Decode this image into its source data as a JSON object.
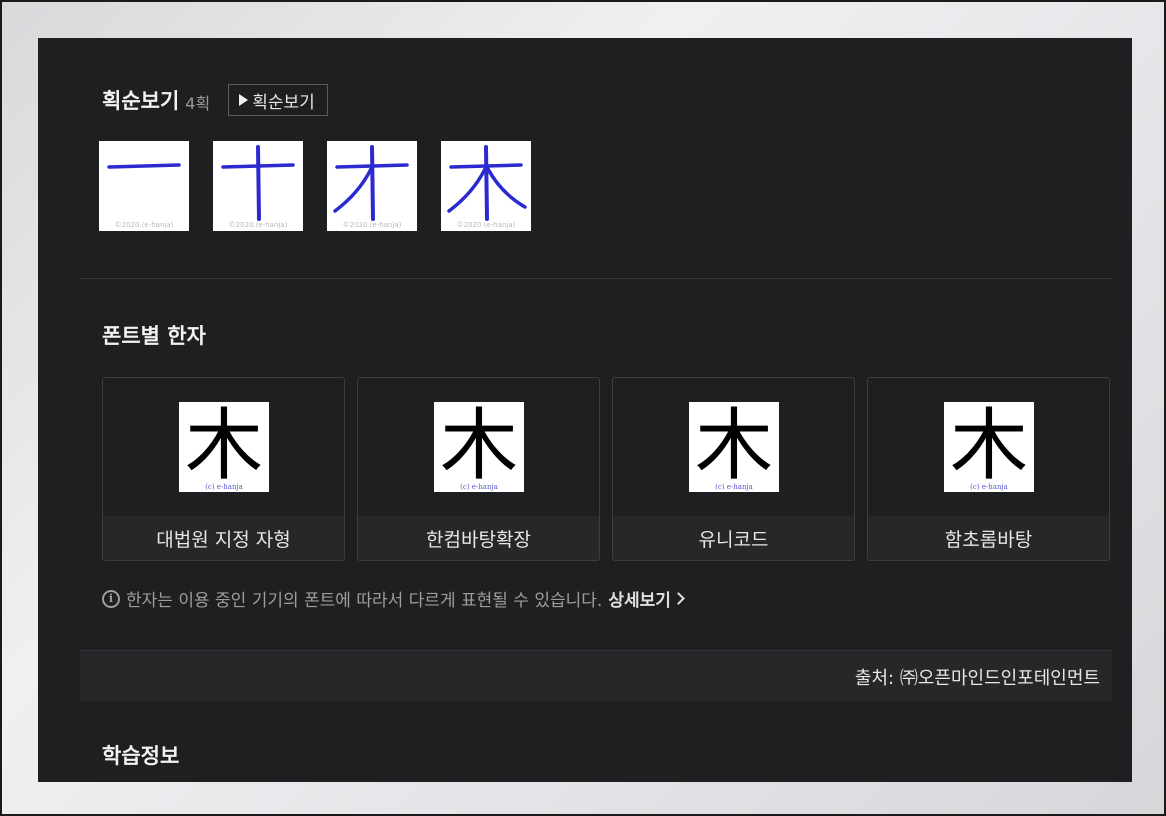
{
  "stroke_order": {
    "title": "획순보기",
    "count": "4획",
    "play_label": "획순보기",
    "watermark": "©2020.(e-hanja)",
    "steps": [
      1,
      2,
      3,
      4
    ]
  },
  "fonts_section": {
    "title": "폰트별 한자",
    "character": "木",
    "watermark": "(c) e-hanja",
    "cards": [
      {
        "label": "대법원 지정 자형"
      },
      {
        "label": "한컴바탕확장"
      },
      {
        "label": "유니코드"
      },
      {
        "label": "함초롬바탕"
      }
    ]
  },
  "notice": {
    "icon": "info-icon",
    "text": "한자는 이용 중인 기기의 폰트에 따라서 다르게 표현될 수 있습니다.",
    "link_label": "상세보기"
  },
  "source": {
    "text": "출처: ㈜오픈마인드인포테인먼트"
  },
  "learning_section": {
    "title": "학습정보"
  },
  "colors": {
    "panel_bg": "#1e1f21",
    "stroke_color": "#2a2ad0",
    "text": "#e6e6e6"
  }
}
